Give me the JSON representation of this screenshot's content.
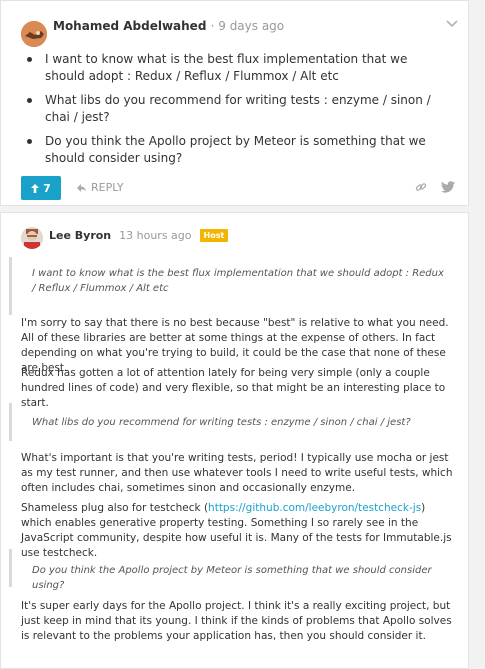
{
  "question": {
    "author": "Mohamed Abdelwahed",
    "time": "· 9 days ago",
    "items": [
      "I want to know what is the best flux implementation that we should adopt : Redux / Reflux / Flummox / Alt etc",
      "What libs do you recommend for writing tests : enzyme / sinon / chai / jest?",
      "Do you think the Apollo project by Meteor is something that we should consider using?"
    ],
    "votes": "7",
    "reply_label": "REPLY",
    "icons": {
      "upvote": "arrow-up-icon",
      "reply": "reply-arrow-icon",
      "link": "link-icon",
      "twitter": "twitter-icon",
      "collapse": "chevron-down-icon"
    }
  },
  "answer": {
    "author": "Lee Byron",
    "time": "13 hours ago",
    "badge": "Host",
    "quote1": "I want to know what is the best flux implementation that we should adopt : Redux / Reflux / Flummox / Alt etc",
    "p1": "I'm sorry to say that there is no best because \"best\" is relative to what you need. All of these libraries are better at some things at the expense of others. In fact depending on what you're trying to build, it could be the case that none of these are best.",
    "p2": "Redux has gotten a lot of attention lately for being very simple (only a couple hundred lines of code) and very flexible, so that might be an interesting place to start.",
    "quote2": "What libs do you recommend for writing tests : enzyme / sinon / chai / jest?",
    "p3": "What's important is that you're writing tests, period! I typically use mocha or jest as my test runner, and then use whatever tools I need to write useful tests, which often includes chai, sometimes sinon and occasionally enzyme.",
    "p4_before": "Shameless plug also for testcheck (",
    "p4_link": "https://github.com/leebyron/testcheck-js",
    "p4_after": ") which enables generative property testing. Something I so rarely see in the JavaScript community, despite how useful it is. Many of the tests for Immutable.js use testcheck.",
    "quote3": "Do you think the Apollo project by Meteor is something that we should consider using?",
    "p5": "It's super early days for the Apollo project. I think it's a really exciting project, but just keep in mind that its young. I think if the kinds of problems that Apollo solves is relevant to the problems your application has, then you should consider it."
  },
  "colors": {
    "accent": "#1aa1c9",
    "badge": "#f3b600",
    "background": "#f2f2f2"
  }
}
